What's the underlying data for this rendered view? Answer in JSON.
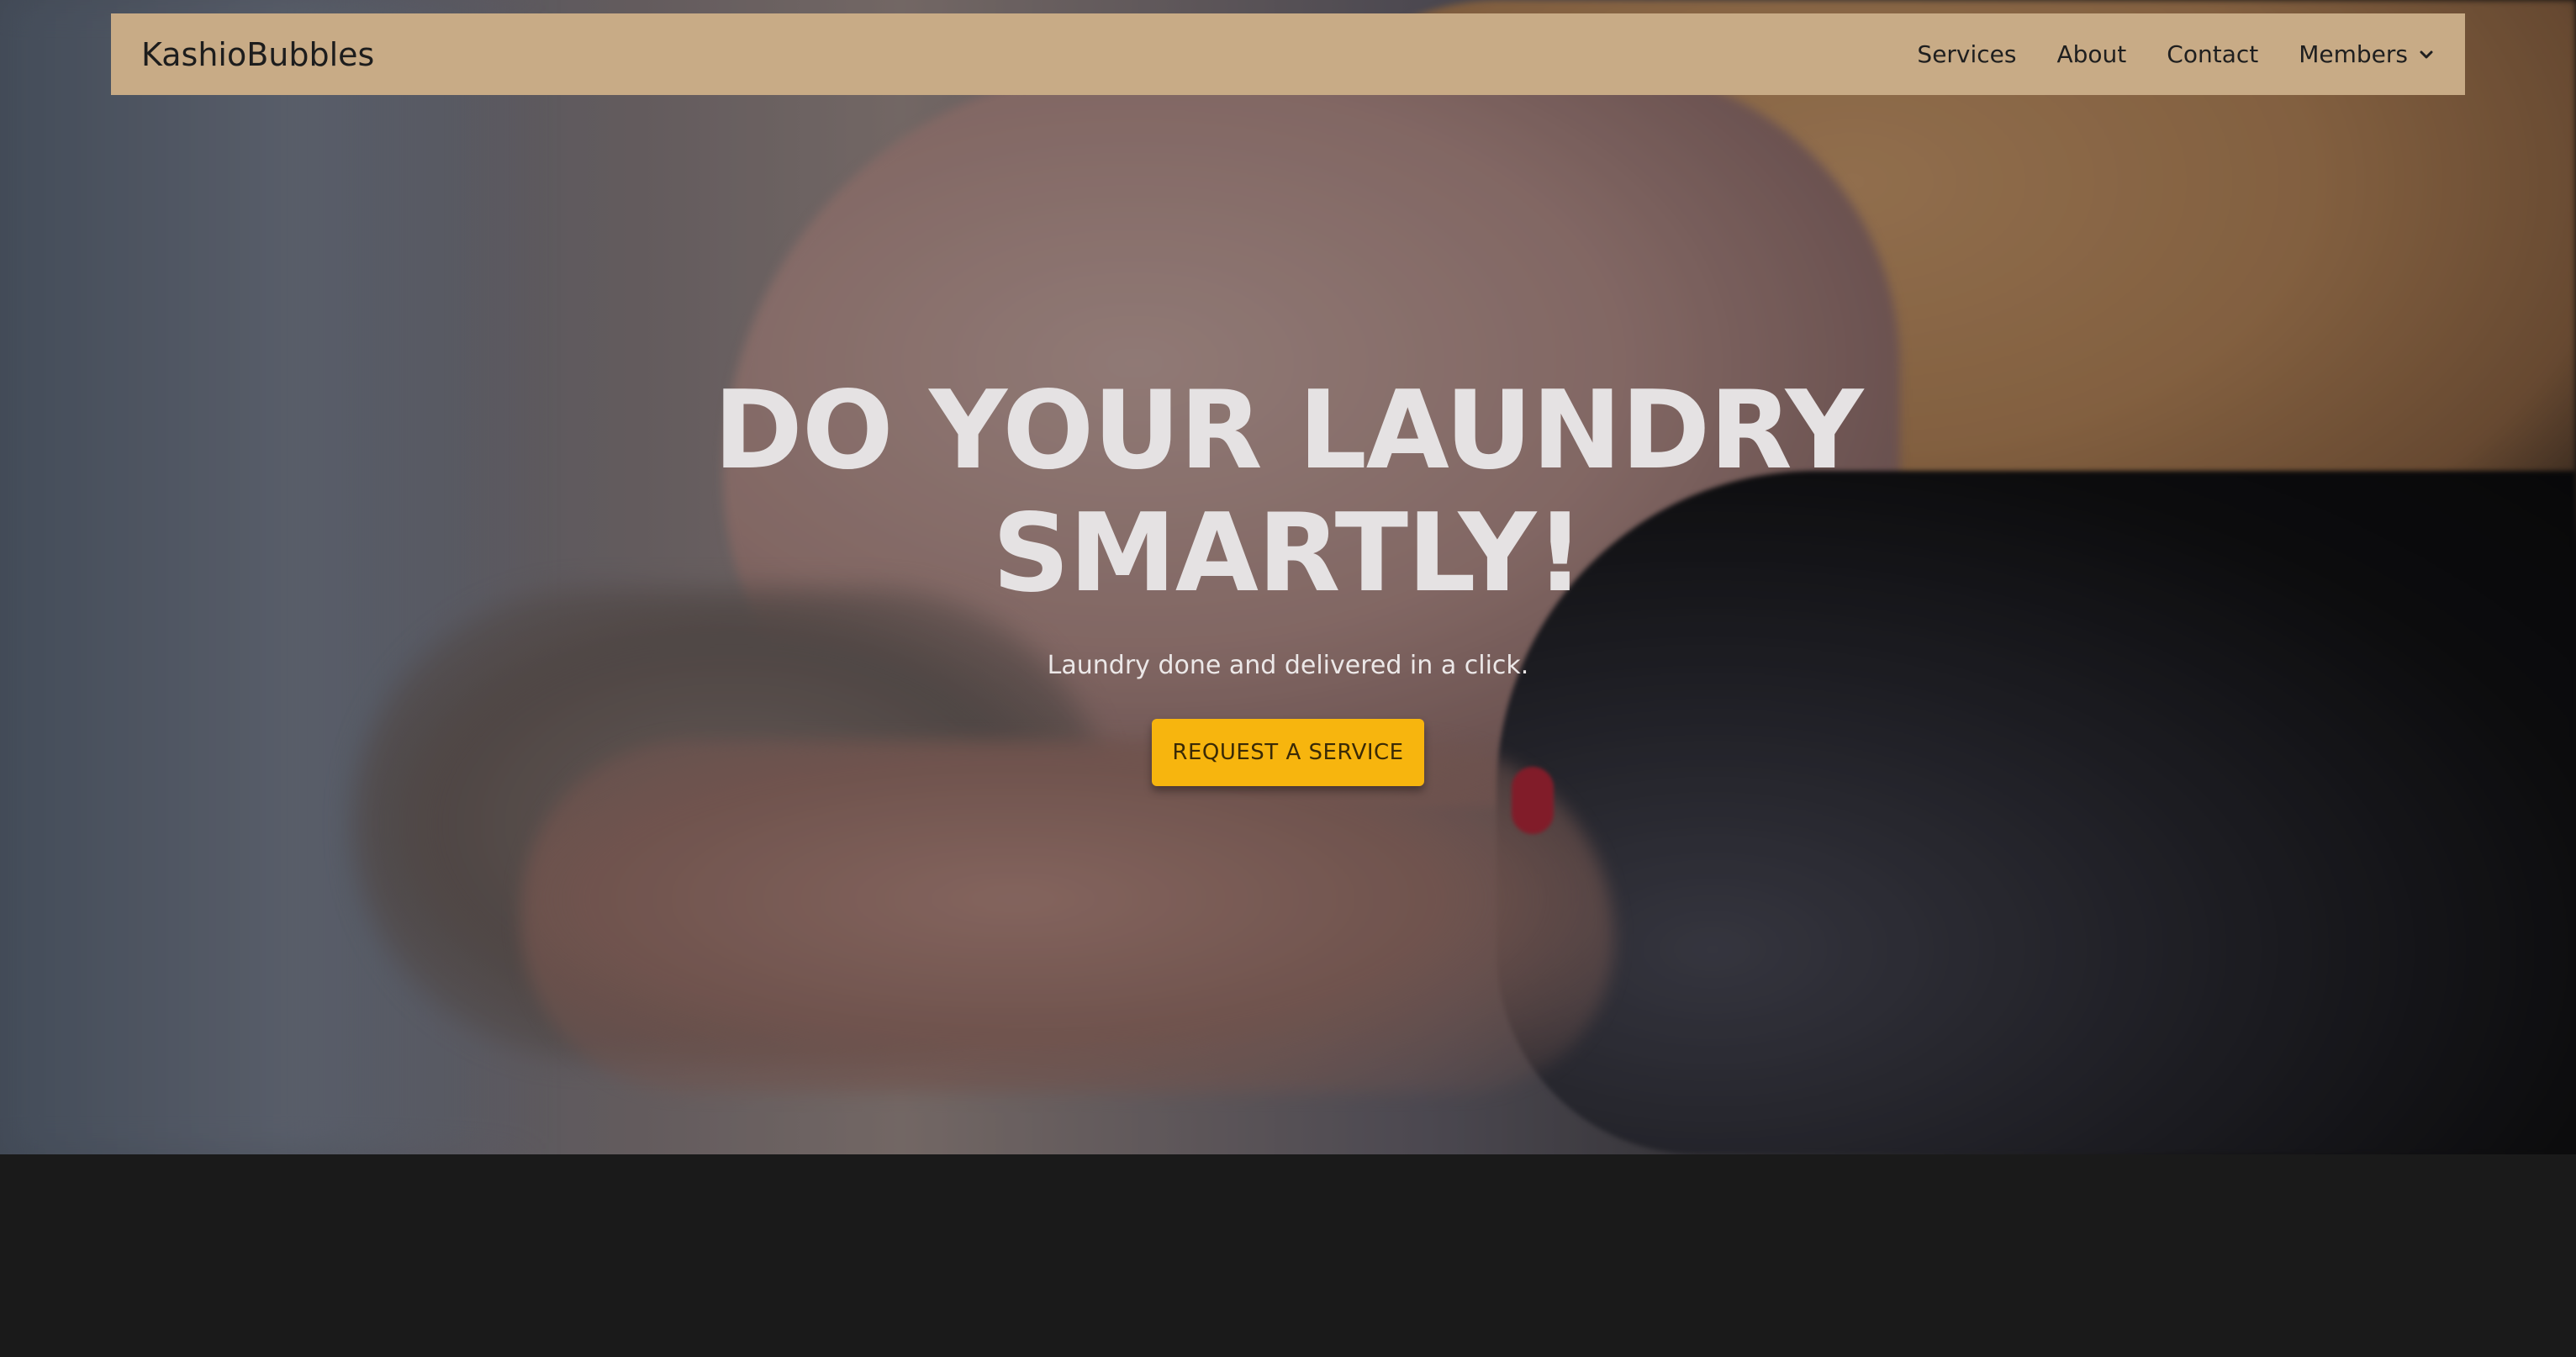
{
  "navbar": {
    "brand": "KashioBubbles",
    "links": [
      {
        "label": "Services"
      },
      {
        "label": "About"
      },
      {
        "label": "Contact"
      }
    ],
    "dropdown": {
      "label": "Members",
      "icon": "chevron-down-icon"
    }
  },
  "hero": {
    "title": "DO YOUR LAUNDRY SMARTLY!",
    "subtitle": "Laundry done and delivered in a click.",
    "cta_label": "REQUEST A SERVICE"
  },
  "colors": {
    "navbar_bg": "#c8ab86",
    "cta_bg": "#f7b50e",
    "page_bg": "#1a1a1a",
    "hero_text": "#e5e2e3"
  }
}
